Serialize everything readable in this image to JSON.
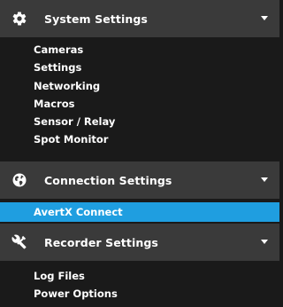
{
  "sections": [
    {
      "title": "System Settings",
      "icon": "gear-icon",
      "expanded": true,
      "items": [
        {
          "label": "Cameras",
          "active": false
        },
        {
          "label": "Settings",
          "active": false
        },
        {
          "label": "Networking",
          "active": false
        },
        {
          "label": "Macros",
          "active": false
        },
        {
          "label": "Sensor / Relay",
          "active": false
        },
        {
          "label": "Spot Monitor",
          "active": false
        }
      ]
    },
    {
      "title": "Connection Settings",
      "icon": "globe-icon",
      "expanded": true,
      "items": [
        {
          "label": "AvertX Connect",
          "active": true
        }
      ]
    },
    {
      "title": "Recorder Settings",
      "icon": "tools-icon",
      "expanded": true,
      "items": [
        {
          "label": "Log Files",
          "active": false
        },
        {
          "label": "Power Options",
          "active": false
        }
      ]
    }
  ],
  "colors": {
    "header_bg": "#3a3a3a",
    "body_bg": "#1a1a1a",
    "active_bg": "#1f9ee0",
    "text": "#ffffff"
  }
}
